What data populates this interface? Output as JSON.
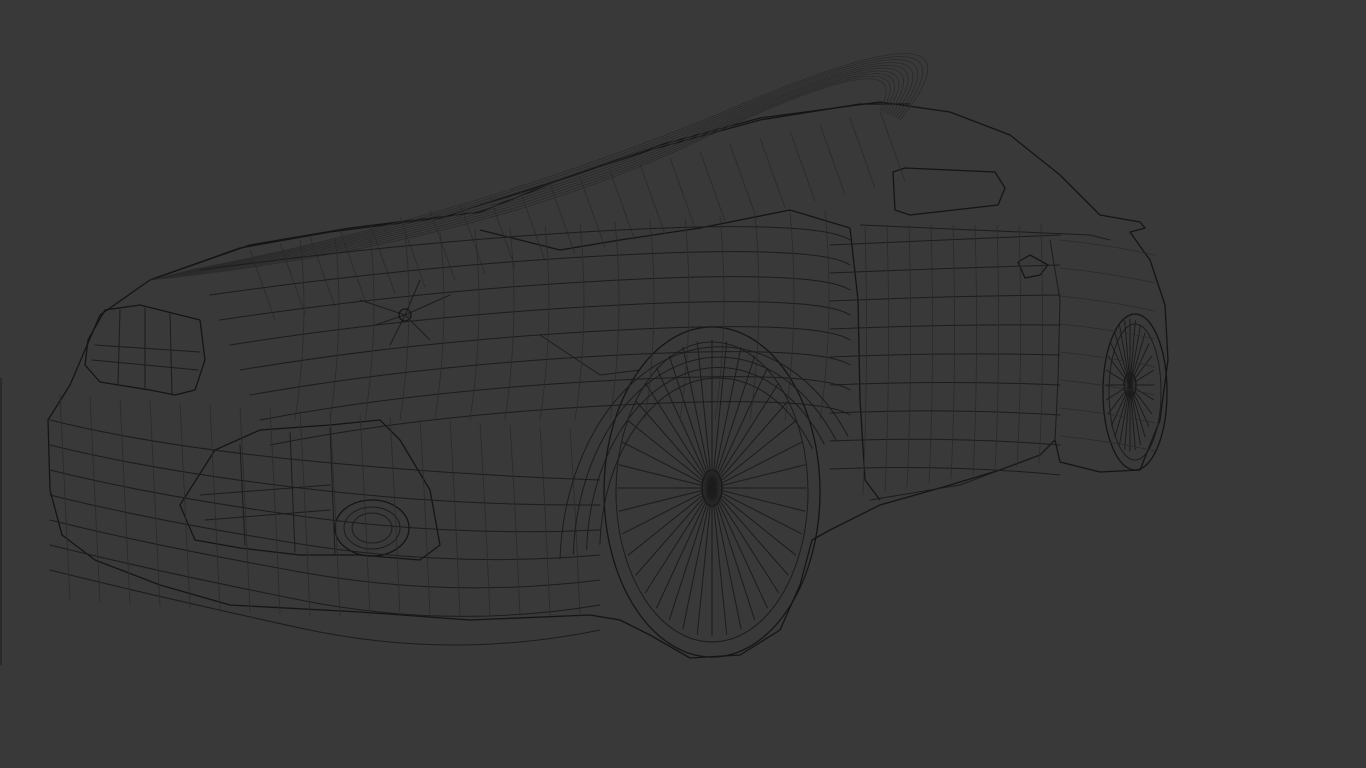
{
  "viewport": {
    "background_color": "#393939",
    "wire_color": "#1c1c1c",
    "shading": "wireframe"
  },
  "model": {
    "icon": "car-wireframe-icon"
  }
}
